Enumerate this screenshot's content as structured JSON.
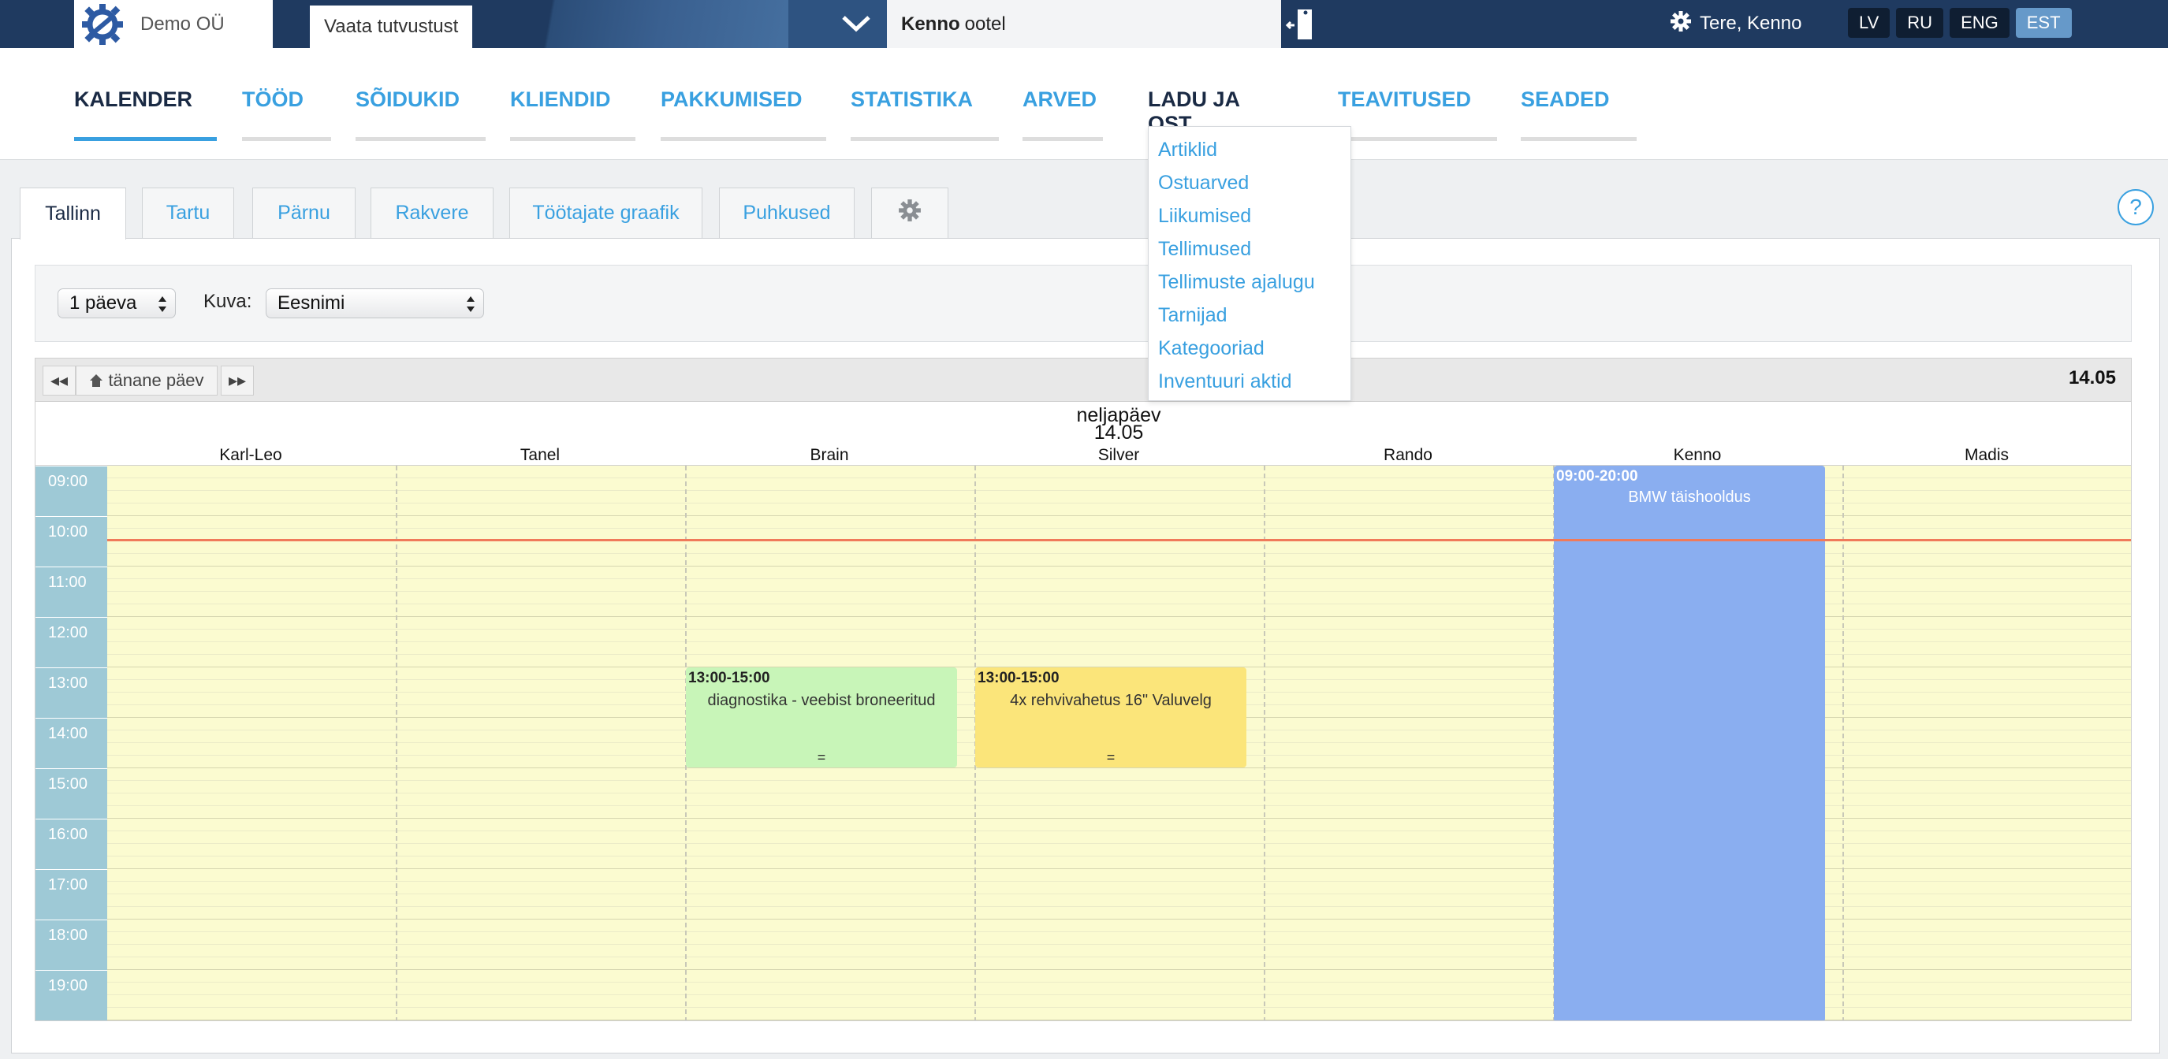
{
  "topbar": {
    "company": "Demo OÜ",
    "view_button": "Vaata tutvustust",
    "status_name": "Kenno",
    "status_text": "ootel",
    "greeting": "Tere, Kenno",
    "languages": [
      "LV",
      "RU",
      "ENG",
      "EST"
    ],
    "active_language": "EST"
  },
  "nav": {
    "items": [
      "KALENDER",
      "TÖÖD",
      "SÕIDUKID",
      "KLIENDID",
      "PAKKUMISED",
      "STATISTIKA",
      "ARVED",
      "LADU JA OST",
      "TEAVITUSED",
      "SEADED"
    ],
    "active": "KALENDER",
    "open": "LADU JA OST"
  },
  "dropdown": {
    "items": [
      "Artiklid",
      "Ostuarved",
      "Liikumised",
      "Tellimused",
      "Tellimuste ajalugu",
      "Tarnijad",
      "Kategooriad",
      "Inventuuri aktid"
    ]
  },
  "tabs": {
    "items": [
      "Tallinn",
      "Tartu",
      "Pärnu",
      "Rakvere",
      "Töötajate graafik",
      "Puhkused"
    ],
    "active": "Tallinn"
  },
  "filters": {
    "period_value": "1 päeva",
    "view_label": "Kuva:",
    "view_value": "Eesnimi"
  },
  "calendar": {
    "prev_label": "◂◂",
    "today_label": "tänane päev",
    "next_label": "▸▸",
    "date_label": "14.05",
    "day_name": "neljapäev",
    "day_date": "14.05",
    "columns": [
      "Karl-Leo",
      "Tanel",
      "Brain",
      "Silver",
      "Rando",
      "Kenno",
      "Madis"
    ],
    "hours": [
      "09:00",
      "10:00",
      "11:00",
      "12:00",
      "13:00",
      "14:00",
      "15:00",
      "16:00",
      "17:00",
      "18:00",
      "19:00"
    ],
    "events": [
      {
        "column": "Brain",
        "time": "13:00-15:00",
        "title": "diagnostika - veebist broneeritud",
        "grip": "=",
        "color": "#c8f5b8"
      },
      {
        "column": "Silver",
        "time": "13:00-15:00",
        "title": "4x rehvivahetus 16\" Valuvelg",
        "grip": "=",
        "color": "#fbe57a"
      },
      {
        "column": "Kenno",
        "time": "09:00-20:00",
        "title": "BMW täishooldus",
        "grip": "",
        "color": "#8aaef0"
      }
    ]
  },
  "colors": {
    "topbar": "#1f3a60",
    "accent": "#39a0e0",
    "now_line": "#f07a5a",
    "time_column": "#9ec9d6"
  }
}
